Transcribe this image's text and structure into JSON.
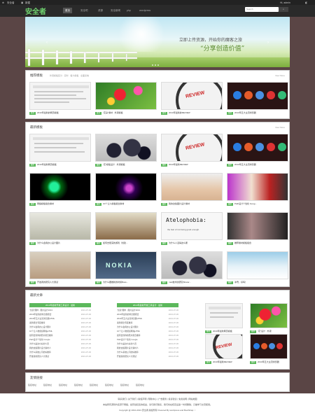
{
  "adminbar": {
    "left": "",
    "new": "新建",
    "right": "Hi, admin"
  },
  "nav": {
    "logo": "安全者",
    "items": [
      "首页",
      "安全吧",
      "资源",
      "安全新闻",
      "php",
      "wordpress"
    ],
    "search_placeholder": "Search"
  },
  "banner": {
    "line1": "立即上传资源，开始你的魔客之旅",
    "line2": "“分享创造价值”"
  },
  "recommend": {
    "title": "推荐模板",
    "subtitle": "外观模板区分 · 实时 · 各大模板 · 全面系统",
    "more": "View More",
    "items": [
      {
        "caption": "2013年最新的网页模板",
        "tag": "推荐"
      },
      {
        "caption": "“花朵”素材 · 外观模板",
        "tag": "推荐"
      },
      {
        "caption": "2013年最新的REVIEW",
        "tag": "推荐"
      },
      {
        "caption": "2013年五大主流浏览器",
        "tag": "推荐"
      }
    ]
  },
  "latest": {
    "title": "最新模板",
    "more": "View More",
    "items": [
      {
        "caption": "2013年最新网页模板",
        "tag": "最新"
      },
      {
        "caption": "“花”模板设计 · 外观模板",
        "tag": "最新"
      },
      {
        "caption": "2013年最新REVIEW",
        "tag": "最新"
      },
      {
        "caption": "2013年五大主流浏览器",
        "tag": "最新"
      },
      {
        "caption": "网络模板组合素材",
        "tag": "最新"
      },
      {
        "caption": "10个让人模板组合素材",
        "tag": "最新"
      },
      {
        "caption": "我的这些图片设计素材",
        "tag": "最新"
      },
      {
        "caption": "Path设计个性化 Goog...",
        "tag": "最新"
      },
      {
        "caption": "为什么会用办公设计图片",
        "tag": "最新"
      },
      {
        "caption": "如何去很深的游戏（创建...",
        "tag": "最新"
      },
      {
        "caption": "为什么人活得这么累",
        "tag": "最新"
      },
      {
        "caption": "推荐素材模板组合",
        "tag": "最新"
      },
      {
        "caption": "开发者的研究人大测试",
        "tag": "最新"
      },
      {
        "caption": "为什么要推新的时候Boss...",
        "tag": "最新"
      },
      {
        "caption": "mail技术的研究Sharer...",
        "tag": "最新"
      },
      {
        "caption": "冰雪，好吗！",
        "tag": "最新"
      }
    ]
  },
  "articles": {
    "title": "最新文章",
    "col1": {
      "head": "2013年最新开放工具设计 · 最新",
      "rows": [
        "“创意”图样 · 图片设计2013",
        "2013年最新的浏览器组合",
        "2013年五大主流浏览器HTML",
        "案例组合专区推荐",
        "为什么会用办公设计图片",
        "10个让人类组织网站HTML",
        "如何去找你的照片组合推荐",
        "Path设计个性化 Google",
        "为什么是这么好的人员",
        "我的这些图片设计素材人",
        "为什么系统公司的好推荐",
        "开发者的研究人大测试"
      ],
      "date": "2013-07-30"
    },
    "col2": {
      "head": "2013年最新开放工具设计 · 最新",
      "rows": [
        "“创意”图样 · 图片设计2013",
        "2013年最新的浏览器组合",
        "2013年五大主流浏览器HTML",
        "案例组合专区推荐",
        "为什么会用办公设计图片",
        "10个让人类组织网站HTML",
        "如何去找你的照片组合推荐",
        "Path设计个性化 Google",
        "为什么是这么好的人员",
        "我的这些图片设计素材人",
        "为什么系统公司的好推荐",
        "开发者的研究人大测试"
      ],
      "date": "2013-07-30"
    },
    "thumbs": [
      {
        "caption": "2013年最新网页模板",
        "tag": "推荐"
      },
      {
        "caption": "“花”设计 · 外观",
        "tag": "推荐"
      },
      {
        "caption": "2013年最新REVIEW",
        "tag": "推荐"
      },
      {
        "caption": "2013年五大主流浏览器",
        "tag": "推荐"
      }
    ]
  },
  "friendlinks": {
    "title": "友情链接",
    "items": [
      "链接地址",
      "链接地址",
      "链接地址",
      "链接地址",
      "链接地址",
      "链接地址",
      "链接地址",
      "链接地址"
    ]
  },
  "footer": {
    "line1": "联系我们 | 关于我们 | 版权声明 | 帮助中心 | 广告服务 | 投诉建议 | 免责说明 | 网站地图",
    "line2": "本站所有源码均来源于网络，如有侵犯您的权益，请与我们联系，我们将在核实后第一时间删除，只做学习交流使用。",
    "line3": "Copyright @ 2010-2013 安全者 版权所有 Powered By wordpress and BootStrap ♡"
  }
}
